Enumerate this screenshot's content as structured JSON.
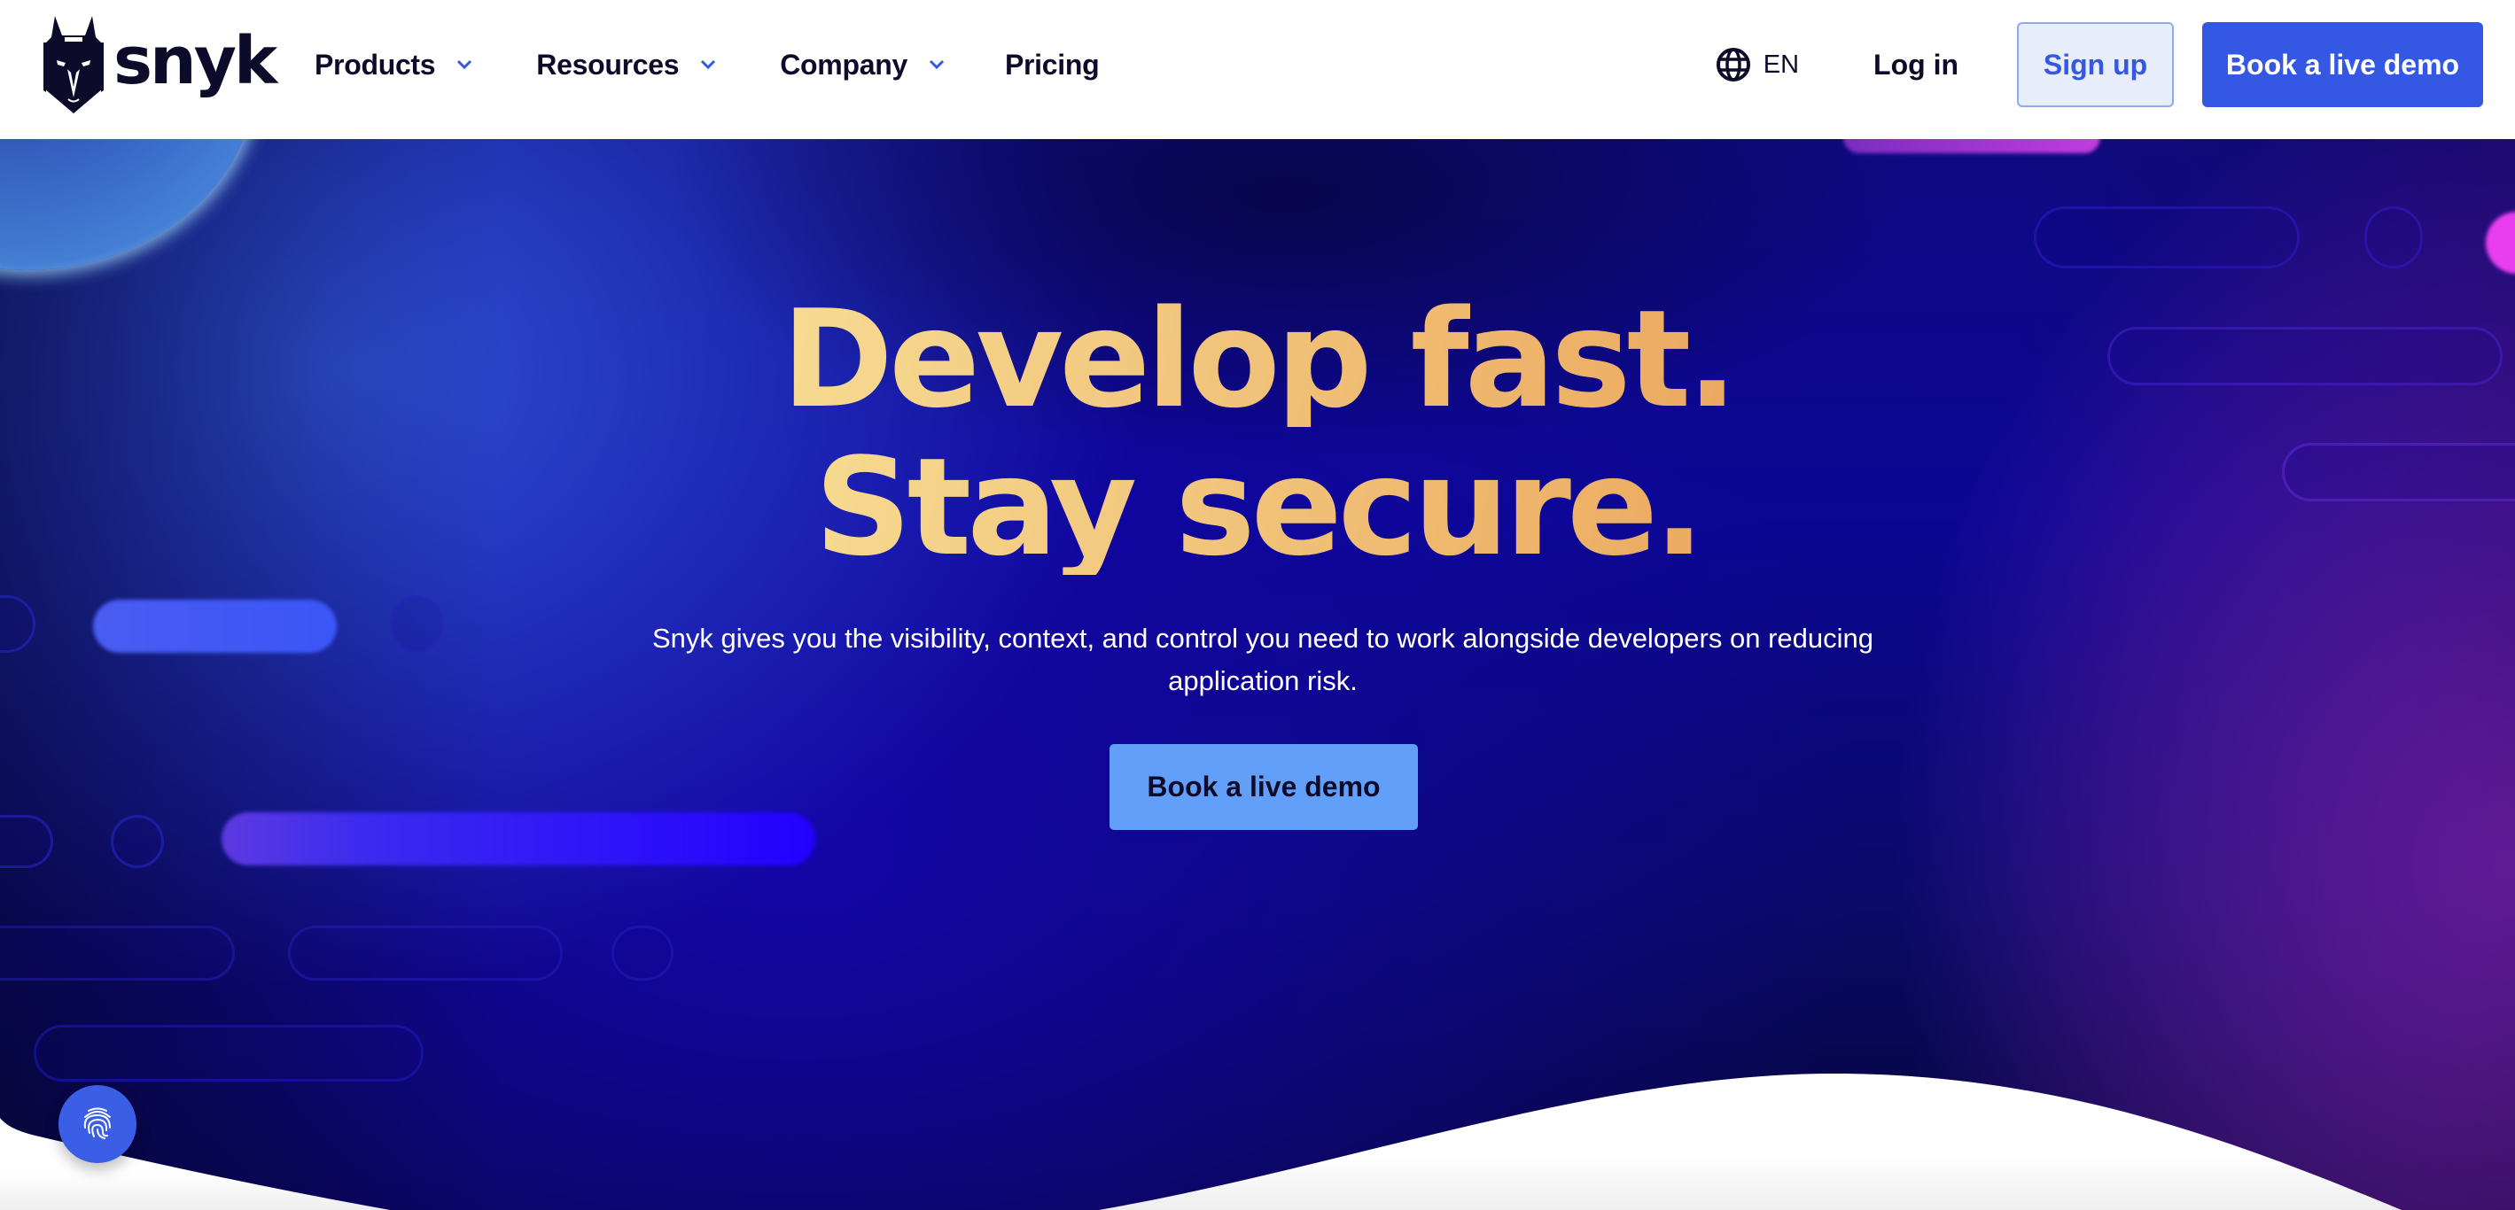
{
  "header": {
    "logo_text": "snyk",
    "logo_icon": "snyk-dog-icon",
    "nav": [
      {
        "label": "Products",
        "has_dropdown": true,
        "icon": "chevron-down-icon"
      },
      {
        "label": "Resources",
        "has_dropdown": true,
        "icon": "chevron-down-icon"
      },
      {
        "label": "Company",
        "has_dropdown": true,
        "icon": "chevron-down-icon"
      },
      {
        "label": "Pricing",
        "has_dropdown": false
      }
    ],
    "language": {
      "icon": "globe-icon",
      "label": "EN"
    },
    "login_label": "Log in",
    "signup_label": "Sign up",
    "demo_label": "Book a live demo"
  },
  "hero": {
    "title_line1": "Develop fast.",
    "title_line2": "Stay secure.",
    "subtitle": "Snyk gives you the visibility, context, and control you need to work alongside developers on reducing application risk.",
    "cta_label": "Book a live demo"
  },
  "floating_button": {
    "icon": "fingerprint-icon"
  },
  "colors": {
    "brand_dark": "#0d0b2a",
    "primary_blue": "#3558e4",
    "signup_bg": "#e7edfb",
    "signup_border": "#8ea9ee",
    "cta_light_blue": "#619ff9",
    "title_gradient_start": "#f7dc93",
    "title_gradient_end": "#eba85f",
    "hero_bg_deep": "#0c0794",
    "hero_accent_magenta": "#e83ef0"
  }
}
